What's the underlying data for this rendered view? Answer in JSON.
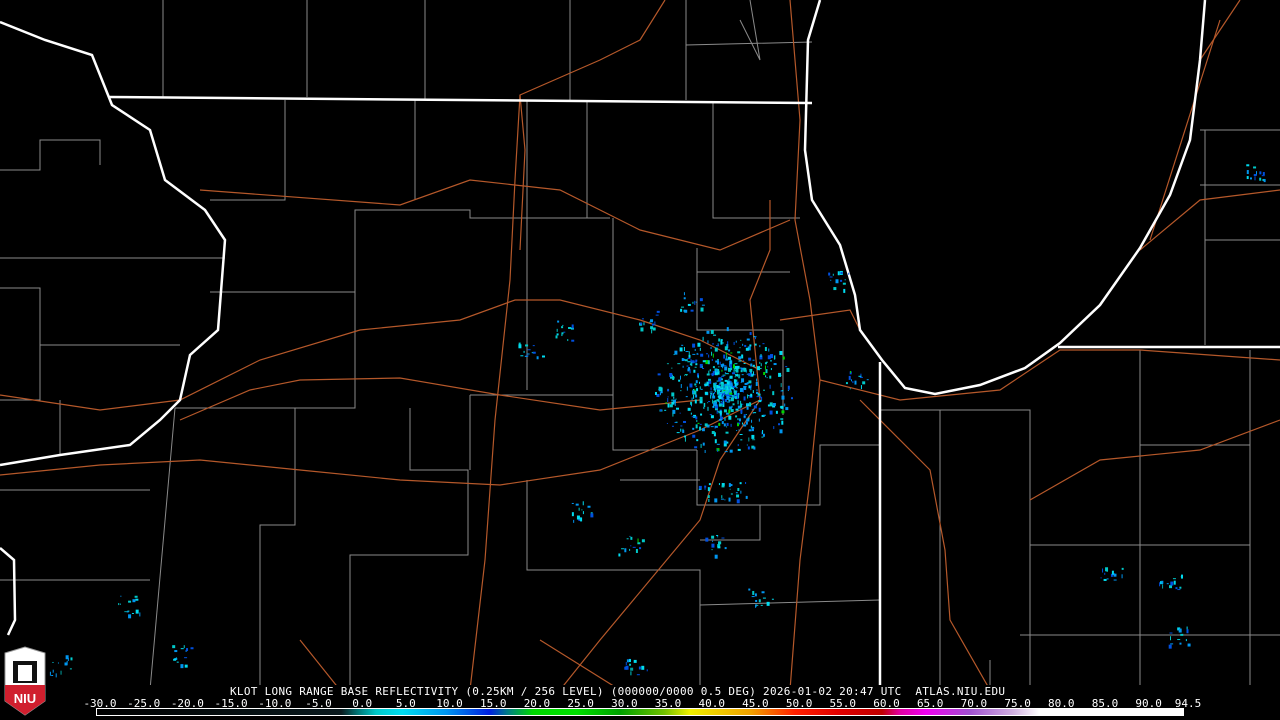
{
  "product_title": "KLOT LONG RANGE BASE REFLECTIVITY (0.25KM / 256 LEVEL) (000000/0000 0.5 DEG) 2026-01-02 20:47 UTC  ATLAS.NIU.EDU",
  "logo_text": "NIU",
  "colorbar": {
    "min": -30.0,
    "max": 94.5,
    "ticks": [
      "-30.0",
      "-25.0",
      "-20.0",
      "-15.0",
      "-10.0",
      "-5.0",
      "0.0",
      "5.0",
      "10.0",
      "15.0",
      "20.0",
      "25.0",
      "30.0",
      "35.0",
      "40.0",
      "45.0",
      "50.0",
      "55.0",
      "60.0",
      "65.0",
      "70.0",
      "75.0",
      "80.0",
      "85.0",
      "90.0",
      "94.5"
    ],
    "stops": [
      {
        "v": -30,
        "c": "#000000"
      },
      {
        "v": -2,
        "c": "#0a1a1e"
      },
      {
        "v": 0,
        "c": "#007a7a"
      },
      {
        "v": 2,
        "c": "#00c8c8"
      },
      {
        "v": 5,
        "c": "#00dcf0"
      },
      {
        "v": 10,
        "c": "#0096f0"
      },
      {
        "v": 15,
        "c": "#0020e0"
      },
      {
        "v": 17,
        "c": "#007a8a"
      },
      {
        "v": 20,
        "c": "#00d800"
      },
      {
        "v": 25,
        "c": "#00e000"
      },
      {
        "v": 30,
        "c": "#00a000"
      },
      {
        "v": 35,
        "c": "#70c000"
      },
      {
        "v": 38,
        "c": "#f0f000"
      },
      {
        "v": 45,
        "c": "#f0a000"
      },
      {
        "v": 50,
        "c": "#ff2000"
      },
      {
        "v": 55,
        "c": "#e00000"
      },
      {
        "v": 60,
        "c": "#c00000"
      },
      {
        "v": 62,
        "c": "#e000a0"
      },
      {
        "v": 65,
        "c": "#f000f0"
      },
      {
        "v": 70,
        "c": "#a050d0"
      },
      {
        "v": 75,
        "c": "#d0b0e0"
      },
      {
        "v": 78,
        "c": "#ffffff"
      },
      {
        "v": 94.5,
        "c": "#ffffff"
      }
    ]
  },
  "colors": {
    "border": "#ffffff",
    "county": "#8a8a8a",
    "road": "#b5582a",
    "background": "#000000",
    "logo_red": "#d01f2e"
  }
}
